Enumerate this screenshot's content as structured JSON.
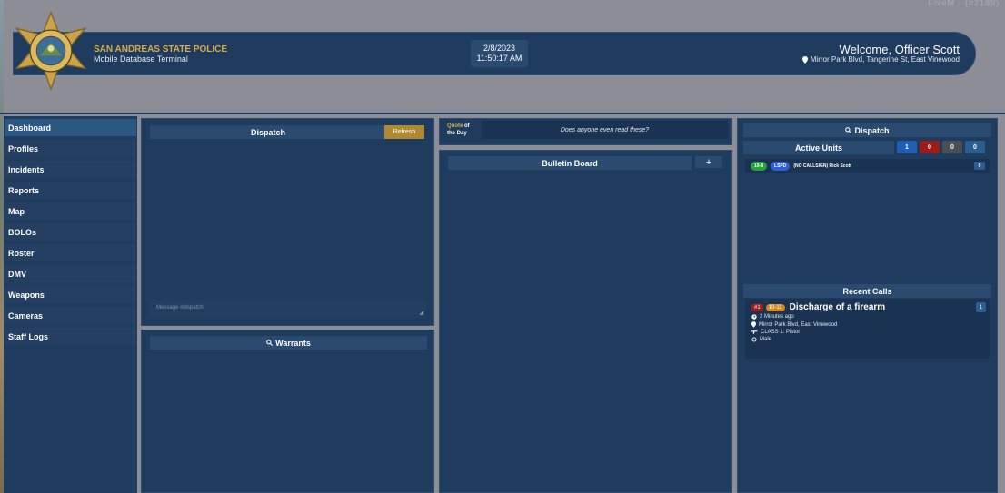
{
  "header": {
    "agency": "SAN ANDREAS STATE POLICE",
    "subtitle": "Mobile Database Terminal",
    "date": "2/8/2023",
    "time": "11:50:17 AM",
    "welcome": "Welcome, Officer Scott",
    "location": "Mirror Park Blvd, Tangerine St, East Vinewood",
    "badge_text": "SAN ANDREAS STATE POLICE"
  },
  "corner_label": "FiveM · (b2189)",
  "sidebar": {
    "items": [
      {
        "label": "Dashboard",
        "active": true
      },
      {
        "label": "Profiles"
      },
      {
        "label": "Incidents"
      },
      {
        "label": "Reports"
      },
      {
        "label": "Map"
      },
      {
        "label": "BOLOs"
      },
      {
        "label": "Roster"
      },
      {
        "label": "DMV"
      },
      {
        "label": "Weapons"
      },
      {
        "label": "Cameras"
      },
      {
        "label": "Staff Logs"
      }
    ]
  },
  "dispatch": {
    "title": "Dispatch",
    "refresh_label": "Refresh",
    "message_placeholder": "Message #dispatch"
  },
  "warrants": {
    "title": "Warrants"
  },
  "quote": {
    "label_1": "Quote",
    "label_2": "of",
    "label_3": "the Day",
    "text": "Does anyone even read these?"
  },
  "bulletin": {
    "title": "Bulletin Board",
    "add_label": "+"
  },
  "dispatch_panel": {
    "title": "Dispatch",
    "active_units_label": "Active Units",
    "counts": [
      {
        "value": "1",
        "color": "#1f5fb3"
      },
      {
        "value": "0",
        "color": "#9c1c1c"
      },
      {
        "value": "0",
        "color": "#4a4e55"
      },
      {
        "value": "0",
        "color": "#2b5d8f"
      }
    ],
    "unit": {
      "status": "10-8",
      "dept": "LSPD",
      "name": "(NO CALLSIGN) Rick Scott",
      "count": "0"
    },
    "recent_calls_label": "Recent Calls",
    "call": {
      "number": "#1",
      "code": "10-11",
      "title": "Discharge of a firearm",
      "badge": "1",
      "time": "2 Minutes ago",
      "location": "Mirror Park Blvd, East Vinewood",
      "weapon": "CLASS 1: Pistol",
      "gender": "Male"
    }
  },
  "colors": {
    "gold": "#d6ad4a",
    "panel": "#1f3b5d",
    "header_strip": "#2a4a70",
    "refresh": "#b08a2e"
  }
}
